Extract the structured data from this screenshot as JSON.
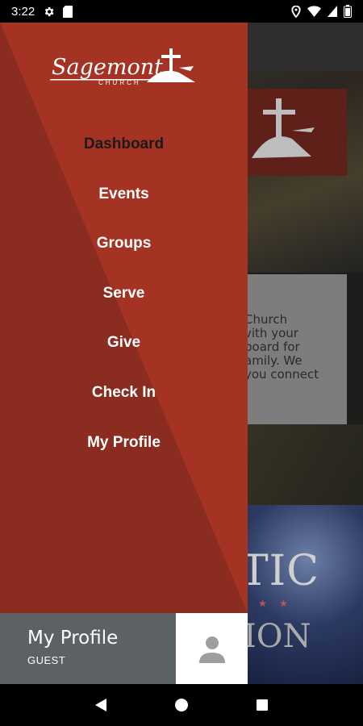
{
  "status_bar": {
    "time": "3:22",
    "icons_left": [
      "gear-icon",
      "sd-card-icon"
    ],
    "icons_right": [
      "location-icon",
      "wifi-icon",
      "signal-icon",
      "battery-icon"
    ]
  },
  "drawer": {
    "logo_text": "Sagemont",
    "logo_subtext": "CHURCH",
    "menu": [
      {
        "label": "Dashboard",
        "active": true
      },
      {
        "label": "Events",
        "active": false
      },
      {
        "label": "Groups",
        "active": false
      },
      {
        "label": "Serve",
        "active": false
      },
      {
        "label": "Give",
        "active": false
      },
      {
        "label": "Check In",
        "active": false
      },
      {
        "label": "My Profile",
        "active": false
      }
    ],
    "profile": {
      "name": "My Profile",
      "role": "GUEST"
    }
  },
  "background": {
    "card_lines": [
      "Church",
      "vith your",
      "board for",
      "amily. We",
      "you connect"
    ],
    "banner_line1": "TIC",
    "banner_line2": "ION"
  },
  "colors": {
    "drawer_dark": "#8a2d20",
    "drawer_light": "#a43324",
    "profile_bar": "#5c6163",
    "active_item": "#1a1a1a"
  }
}
